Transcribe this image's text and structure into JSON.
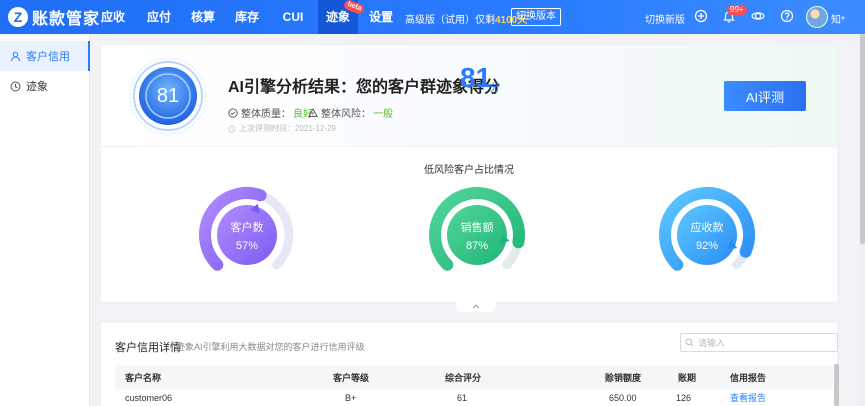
{
  "app": {
    "logo_letter": "Z",
    "name": "账款管家"
  },
  "nav": [
    {
      "label": "应收",
      "active": false
    },
    {
      "label": "应付",
      "active": false
    },
    {
      "label": "核算",
      "active": false
    },
    {
      "label": "库存",
      "active": false
    },
    {
      "label": "CUI",
      "active": false
    },
    {
      "label": "迹象",
      "active": true,
      "badge": "beta"
    },
    {
      "label": "设置",
      "active": false
    }
  ],
  "version": {
    "text": "高级版（试用）仅剩",
    "days": "4100天",
    "switch_label": "切换版本"
  },
  "header_right": {
    "new_version": "切换新版",
    "notif_badge": "99+",
    "username": "知*"
  },
  "sidebar": [
    {
      "label": "客户信用",
      "icon": "user-icon",
      "active": true
    },
    {
      "label": "迹象",
      "icon": "clock-icon",
      "active": false
    }
  ],
  "score": {
    "value": "81",
    "title": "AI引擎分析结果：您的客户群迹象得分",
    "unit": "分",
    "quality_label": "整体质量：",
    "quality_value": "良好",
    "risk_label": "整体风险：",
    "risk_value": "一般",
    "last_eval": "上次评测时间：2021-12-29",
    "ai_button": "AI评测"
  },
  "gauges": {
    "title": "低风险客户占比情况",
    "items": [
      {
        "label": "客户数",
        "percent": "57%",
        "value": 57,
        "color_start": "#b38bff",
        "color_end": "#7a5cf0",
        "track": "#e6e9f5"
      },
      {
        "label": "销售额",
        "percent": "87%",
        "value": 87,
        "color_start": "#52d59a",
        "color_end": "#1fb577",
        "track": "#e3ecea"
      },
      {
        "label": "应收款",
        "percent": "92%",
        "value": 92,
        "color_start": "#5ec8ff",
        "color_end": "#2a8cf5",
        "track": "#e3eaf3"
      }
    ]
  },
  "table": {
    "title": "客户信用详情",
    "subtitle": "迹象AI引擎利用大数据对您的客户进行信用评级",
    "search_placeholder": "请输入",
    "headers": [
      "客户名称",
      "客户等级",
      "综合评分",
      "赊销额度",
      "账期",
      "信用报告"
    ],
    "rows": [
      [
        "customer06",
        "B+",
        "61",
        "650.00",
        "126",
        "查看报告"
      ]
    ]
  }
}
